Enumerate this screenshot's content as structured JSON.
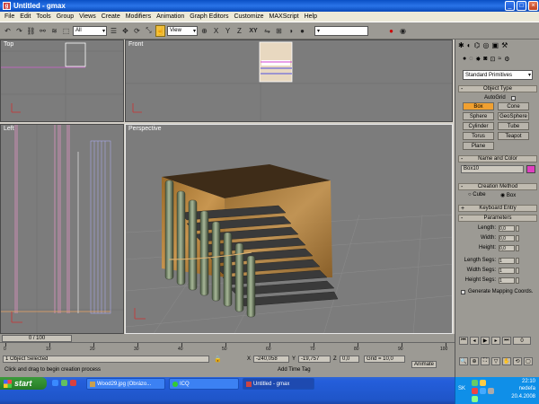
{
  "window": {
    "title": "Untitled - gmax",
    "min": "_",
    "max": "□",
    "close": "×"
  },
  "menu": [
    "File",
    "Edit",
    "Tools",
    "Group",
    "Views",
    "Create",
    "Modifiers",
    "Animation",
    "Graph Editors",
    "Customize",
    "MAXScript",
    "Help"
  ],
  "toolbar": {
    "selection_filter": "All",
    "ref_coord": "View",
    "axis": "XY"
  },
  "viewports": {
    "top": "Top",
    "front": "Front",
    "left": "Left",
    "perspective": "Perspective"
  },
  "command_panel": {
    "category": "Standard Primitives",
    "object_type": {
      "header": "Object Type",
      "autogrid": "AutoGrid",
      "buttons": [
        "Box",
        "Cone",
        "Sphere",
        "GeoSphere",
        "Cylinder",
        "Tube",
        "Torus",
        "Teapot",
        "Plane"
      ],
      "active": "Box"
    },
    "name_color": {
      "header": "Name and Color",
      "name": "Box10",
      "color": "#e040c0"
    },
    "creation_method": {
      "header": "Creation Method",
      "cube": "Cube",
      "box": "Box"
    },
    "keyboard_entry": {
      "header": "Keyboard Entry"
    },
    "parameters": {
      "header": "Parameters",
      "length": "Length:",
      "length_val": "0,0",
      "width": "Width:",
      "width_val": "0,0",
      "height": "Height:",
      "height_val": "0,0",
      "length_segs": "Length Segs:",
      "length_segs_val": "1",
      "width_segs": "Width Segs:",
      "width_segs_val": "1",
      "height_segs": "Height Segs:",
      "height_segs_val": "1",
      "gen_coords": "Generate Mapping Coords."
    }
  },
  "time": {
    "slider": "0 / 100",
    "ticks": [
      "0",
      "10",
      "20",
      "30",
      "40",
      "50",
      "60",
      "70",
      "80",
      "90",
      "100"
    ]
  },
  "status": {
    "selected": "1 Object Selected",
    "prompt": "Click and drag to begin creation process",
    "x_label": "X",
    "x": "-240,058",
    "y_label": "Y",
    "y": "-19,757",
    "z_label": "Z",
    "z": "0,0",
    "grid": "Grid = 10,0",
    "add_time_tag": "Add Time Tag",
    "animate": "Animate"
  },
  "taskbar": {
    "start": "start",
    "tasks": [
      "Wood29.jpg (Obrázo...",
      "ICQ",
      "Untitled - gmax"
    ],
    "lang": "SK",
    "time": "22:10",
    "day": "nedeľa",
    "date": "20.4.2008"
  }
}
